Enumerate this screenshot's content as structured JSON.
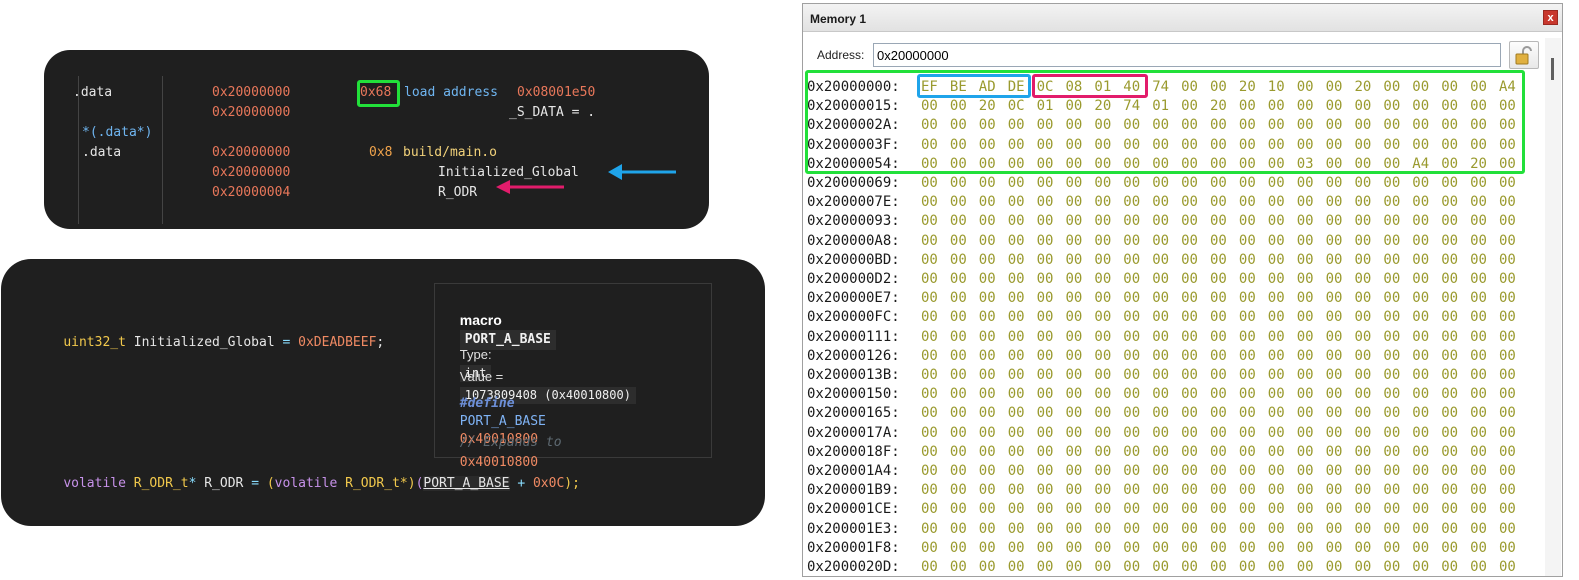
{
  "linker_map": {
    "rows": [
      {
        "section": ".data",
        "address": "0x20000000",
        "size": "0x68",
        "rest": "load address",
        "load_addr": "0x08001e50"
      },
      {
        "address": "0x20000000",
        "symbol": "_S_DATA = ."
      },
      {
        "section": "*(.data*)"
      },
      {
        "section": ".data",
        "address": "0x20000000",
        "size": "0x8",
        "rest": "build/main.o"
      },
      {
        "address": "0x20000000",
        "symbol": "Initialized_Global"
      },
      {
        "address": "0x20000004",
        "symbol": "R_ODR"
      }
    ],
    "arrow_colors": {
      "blue": "#1fa4ea",
      "red": "#e21c6b"
    },
    "highlight_color": "#22e03a"
  },
  "code": {
    "line1": {
      "type": "uint32_t",
      "name": "Initialized_Global",
      "eq": "=",
      "value": "0xDEADBEEF",
      "semi": ";"
    },
    "line2": {
      "kw1": "volatile",
      "type1": "R_ODR_t",
      "star": "*",
      "name": "R_ODR",
      "eq": "=",
      "open": "(",
      "kw2": "volatile",
      "type2": "R_ODR_t",
      "cast_close": "*)",
      "paren": "(",
      "macro": "PORT_A_BASE",
      "plus": "+",
      "offset": "0x0C",
      "close": ");"
    }
  },
  "hover": {
    "kind": "macro",
    "name": "PORT_A_BASE",
    "type_label": "Type:",
    "type_value": "int",
    "value_label": "Value =",
    "value_value": "1073809408 (0x40010800)",
    "define_kw": "#define",
    "define_name": "PORT_A_BASE",
    "define_value": "0x40010800",
    "comment": "// Expands to",
    "expansion": "0x40010800"
  },
  "memory_window": {
    "title": "Memory 1",
    "close": "x",
    "address_label": "Address:",
    "address_value": "0x20000000",
    "lock_icon": "lock-icon",
    "rows": [
      {
        "addr": "0x20000000:",
        "bytes": [
          "EF",
          "BE",
          "AD",
          "DE",
          "0C",
          "08",
          "01",
          "40",
          "74",
          "00",
          "00",
          "20",
          "10",
          "00",
          "00",
          "20",
          "00",
          "00",
          "00",
          "00",
          "A4"
        ]
      },
      {
        "addr": "0x20000015:",
        "bytes": [
          "00",
          "00",
          "20",
          "0C",
          "01",
          "00",
          "20",
          "74",
          "01",
          "00",
          "20",
          "00",
          "00",
          "00",
          "00",
          "00",
          "00",
          "00",
          "00",
          "00",
          "00"
        ]
      },
      {
        "addr": "0x2000002A:",
        "bytes": [
          "00",
          "00",
          "00",
          "00",
          "00",
          "00",
          "00",
          "00",
          "00",
          "00",
          "00",
          "00",
          "00",
          "00",
          "00",
          "00",
          "00",
          "00",
          "00",
          "00",
          "00"
        ]
      },
      {
        "addr": "0x2000003F:",
        "bytes": [
          "00",
          "00",
          "00",
          "00",
          "00",
          "00",
          "00",
          "00",
          "00",
          "00",
          "00",
          "00",
          "00",
          "00",
          "00",
          "00",
          "00",
          "00",
          "00",
          "00",
          "00"
        ]
      },
      {
        "addr": "0x20000054:",
        "bytes": [
          "00",
          "00",
          "00",
          "00",
          "00",
          "00",
          "00",
          "00",
          "00",
          "00",
          "00",
          "00",
          "00",
          "03",
          "00",
          "00",
          "00",
          "A4",
          "00",
          "20",
          "00"
        ]
      },
      {
        "addr": "0x20000069:",
        "bytes": [
          "00",
          "00",
          "00",
          "00",
          "00",
          "00",
          "00",
          "00",
          "00",
          "00",
          "00",
          "00",
          "00",
          "00",
          "00",
          "00",
          "00",
          "00",
          "00",
          "00",
          "00"
        ]
      },
      {
        "addr": "0x2000007E:",
        "bytes": [
          "00",
          "00",
          "00",
          "00",
          "00",
          "00",
          "00",
          "00",
          "00",
          "00",
          "00",
          "00",
          "00",
          "00",
          "00",
          "00",
          "00",
          "00",
          "00",
          "00",
          "00"
        ]
      },
      {
        "addr": "0x20000093:",
        "bytes": [
          "00",
          "00",
          "00",
          "00",
          "00",
          "00",
          "00",
          "00",
          "00",
          "00",
          "00",
          "00",
          "00",
          "00",
          "00",
          "00",
          "00",
          "00",
          "00",
          "00",
          "00"
        ]
      },
      {
        "addr": "0x200000A8:",
        "bytes": [
          "00",
          "00",
          "00",
          "00",
          "00",
          "00",
          "00",
          "00",
          "00",
          "00",
          "00",
          "00",
          "00",
          "00",
          "00",
          "00",
          "00",
          "00",
          "00",
          "00",
          "00"
        ]
      },
      {
        "addr": "0x200000BD:",
        "bytes": [
          "00",
          "00",
          "00",
          "00",
          "00",
          "00",
          "00",
          "00",
          "00",
          "00",
          "00",
          "00",
          "00",
          "00",
          "00",
          "00",
          "00",
          "00",
          "00",
          "00",
          "00"
        ]
      },
      {
        "addr": "0x200000D2:",
        "bytes": [
          "00",
          "00",
          "00",
          "00",
          "00",
          "00",
          "00",
          "00",
          "00",
          "00",
          "00",
          "00",
          "00",
          "00",
          "00",
          "00",
          "00",
          "00",
          "00",
          "00",
          "00"
        ]
      },
      {
        "addr": "0x200000E7:",
        "bytes": [
          "00",
          "00",
          "00",
          "00",
          "00",
          "00",
          "00",
          "00",
          "00",
          "00",
          "00",
          "00",
          "00",
          "00",
          "00",
          "00",
          "00",
          "00",
          "00",
          "00",
          "00"
        ]
      },
      {
        "addr": "0x200000FC:",
        "bytes": [
          "00",
          "00",
          "00",
          "00",
          "00",
          "00",
          "00",
          "00",
          "00",
          "00",
          "00",
          "00",
          "00",
          "00",
          "00",
          "00",
          "00",
          "00",
          "00",
          "00",
          "00"
        ]
      },
      {
        "addr": "0x20000111:",
        "bytes": [
          "00",
          "00",
          "00",
          "00",
          "00",
          "00",
          "00",
          "00",
          "00",
          "00",
          "00",
          "00",
          "00",
          "00",
          "00",
          "00",
          "00",
          "00",
          "00",
          "00",
          "00"
        ]
      },
      {
        "addr": "0x20000126:",
        "bytes": [
          "00",
          "00",
          "00",
          "00",
          "00",
          "00",
          "00",
          "00",
          "00",
          "00",
          "00",
          "00",
          "00",
          "00",
          "00",
          "00",
          "00",
          "00",
          "00",
          "00",
          "00"
        ]
      },
      {
        "addr": "0x2000013B:",
        "bytes": [
          "00",
          "00",
          "00",
          "00",
          "00",
          "00",
          "00",
          "00",
          "00",
          "00",
          "00",
          "00",
          "00",
          "00",
          "00",
          "00",
          "00",
          "00",
          "00",
          "00",
          "00"
        ]
      },
      {
        "addr": "0x20000150:",
        "bytes": [
          "00",
          "00",
          "00",
          "00",
          "00",
          "00",
          "00",
          "00",
          "00",
          "00",
          "00",
          "00",
          "00",
          "00",
          "00",
          "00",
          "00",
          "00",
          "00",
          "00",
          "00"
        ]
      },
      {
        "addr": "0x20000165:",
        "bytes": [
          "00",
          "00",
          "00",
          "00",
          "00",
          "00",
          "00",
          "00",
          "00",
          "00",
          "00",
          "00",
          "00",
          "00",
          "00",
          "00",
          "00",
          "00",
          "00",
          "00",
          "00"
        ]
      },
      {
        "addr": "0x2000017A:",
        "bytes": [
          "00",
          "00",
          "00",
          "00",
          "00",
          "00",
          "00",
          "00",
          "00",
          "00",
          "00",
          "00",
          "00",
          "00",
          "00",
          "00",
          "00",
          "00",
          "00",
          "00",
          "00"
        ]
      },
      {
        "addr": "0x2000018F:",
        "bytes": [
          "00",
          "00",
          "00",
          "00",
          "00",
          "00",
          "00",
          "00",
          "00",
          "00",
          "00",
          "00",
          "00",
          "00",
          "00",
          "00",
          "00",
          "00",
          "00",
          "00",
          "00"
        ]
      },
      {
        "addr": "0x200001A4:",
        "bytes": [
          "00",
          "00",
          "00",
          "00",
          "00",
          "00",
          "00",
          "00",
          "00",
          "00",
          "00",
          "00",
          "00",
          "00",
          "00",
          "00",
          "00",
          "00",
          "00",
          "00",
          "00"
        ]
      },
      {
        "addr": "0x200001B9:",
        "bytes": [
          "00",
          "00",
          "00",
          "00",
          "00",
          "00",
          "00",
          "00",
          "00",
          "00",
          "00",
          "00",
          "00",
          "00",
          "00",
          "00",
          "00",
          "00",
          "00",
          "00",
          "00"
        ]
      },
      {
        "addr": "0x200001CE:",
        "bytes": [
          "00",
          "00",
          "00",
          "00",
          "00",
          "00",
          "00",
          "00",
          "00",
          "00",
          "00",
          "00",
          "00",
          "00",
          "00",
          "00",
          "00",
          "00",
          "00",
          "00",
          "00"
        ]
      },
      {
        "addr": "0x200001E3:",
        "bytes": [
          "00",
          "00",
          "00",
          "00",
          "00",
          "00",
          "00",
          "00",
          "00",
          "00",
          "00",
          "00",
          "00",
          "00",
          "00",
          "00",
          "00",
          "00",
          "00",
          "00",
          "00"
        ]
      },
      {
        "addr": "0x200001F8:",
        "bytes": [
          "00",
          "00",
          "00",
          "00",
          "00",
          "00",
          "00",
          "00",
          "00",
          "00",
          "00",
          "00",
          "00",
          "00",
          "00",
          "00",
          "00",
          "00",
          "00",
          "00",
          "00"
        ]
      },
      {
        "addr": "0x2000020D:",
        "bytes": [
          "00",
          "00",
          "00",
          "00",
          "00",
          "00",
          "00",
          "00",
          "00",
          "00",
          "00",
          "00",
          "00",
          "00",
          "00",
          "00",
          "00",
          "00",
          "00",
          "00",
          "00"
        ]
      }
    ],
    "highlight_colors": {
      "block": "#22e03a",
      "initialized_global": "#1fa4ea",
      "r_odr": "#e21c6b"
    }
  }
}
